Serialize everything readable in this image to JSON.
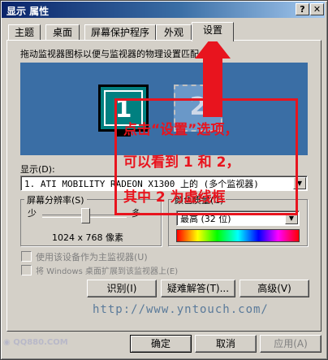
{
  "window": {
    "title": "显示 属性"
  },
  "title_buttons": {
    "help": "?",
    "close": "✕"
  },
  "tabs": [
    {
      "label": "主题"
    },
    {
      "label": "桌面"
    },
    {
      "label": "屏幕保护程序"
    },
    {
      "label": "外观"
    },
    {
      "label": "设置",
      "active": true
    }
  ],
  "instruction": "拖动监视器图标以便与监视器的物理设置匹配。",
  "monitors": {
    "primary_number": "1",
    "secondary_number": "2"
  },
  "display": {
    "label": "显示(D):",
    "value": "1. ATI MOBILITY RADEON X1300 上的 (多个监视器)"
  },
  "resolution": {
    "group_label": "屏幕分辨率(S)",
    "less": "少",
    "more": "多",
    "value": "1024 x 768 像素",
    "slider_level": 0.5
  },
  "color_quality": {
    "group_label": "颜色质量(C)",
    "value": "最高 (32 位)"
  },
  "checkboxes": {
    "primary": "使用该设备作为主监视器(U)",
    "extend": "将 Windows 桌面扩展到该监视器上(E)"
  },
  "buttons": {
    "identify": "识别(I)",
    "troubleshoot": "疑难解答(T)...",
    "advanced": "高级(V)",
    "ok": "确定",
    "cancel": "取消",
    "apply": "应用(A)"
  },
  "annotation": {
    "line1": "点击“设置”选项，",
    "line2": "可以看到 1 和 2，",
    "line3": "其中 2 为虚线框"
  },
  "watermarks": {
    "url": "http://www.yntouch.com/",
    "corner": "QQ880.COM"
  },
  "colors": {
    "title_gradient_start": "#0a246a",
    "desktop_blue": "#3a6ea5",
    "monitor_teal": "#008080",
    "annotation_red": "#e8141e"
  }
}
